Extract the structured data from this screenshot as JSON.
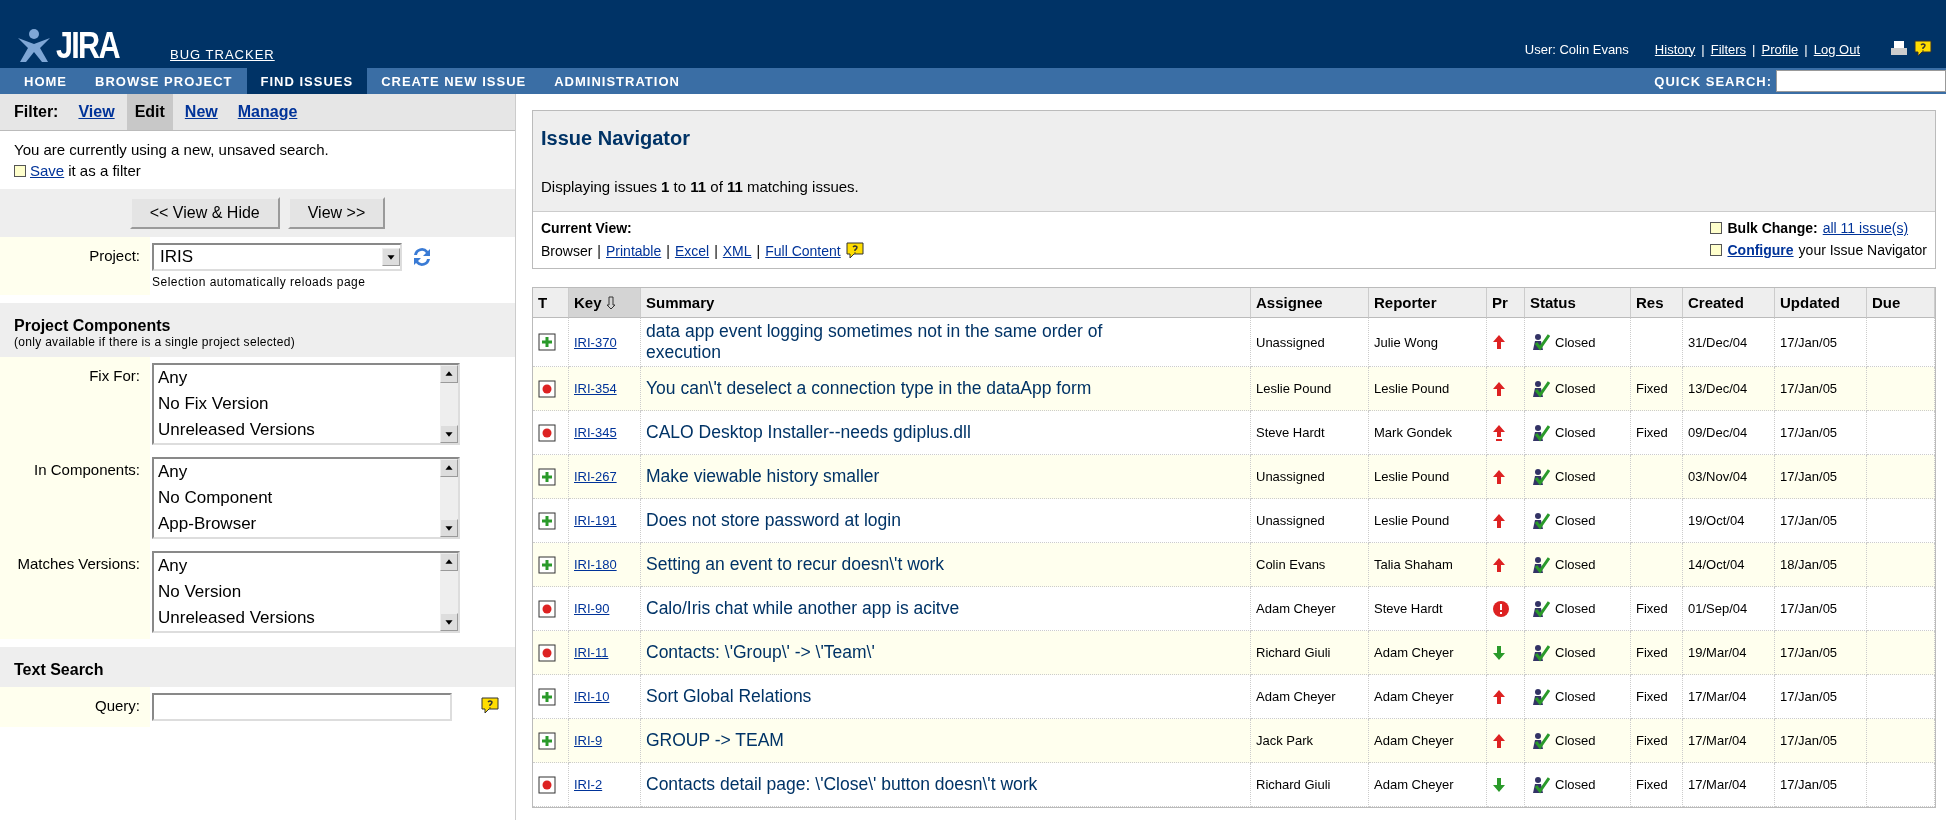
{
  "header": {
    "logo": "JIRA",
    "subtitle": "BUG TRACKER",
    "user": "User: Colin Evans",
    "links": [
      "History",
      "Filters",
      "Profile",
      "Log Out"
    ],
    "separator": "|"
  },
  "nav": {
    "tabs": [
      {
        "label": "HOME",
        "selected": false
      },
      {
        "label": "BROWSE PROJECT",
        "selected": false
      },
      {
        "label": "FIND ISSUES",
        "selected": true
      },
      {
        "label": "CREATE NEW ISSUE",
        "selected": false
      },
      {
        "label": "ADMINISTRATION",
        "selected": false
      }
    ],
    "quick_search": "QUICK SEARCH:"
  },
  "filter": {
    "label": "Filter:",
    "tabs": [
      {
        "label": "View",
        "selected": false
      },
      {
        "label": "Edit",
        "selected": true
      },
      {
        "label": "New",
        "selected": false
      },
      {
        "label": "Manage",
        "selected": false
      }
    ],
    "message": "You are currently using a new, unsaved search.",
    "save_link": "Save",
    "save_text": "it as a filter",
    "buttons": [
      "<< View & Hide",
      "View >>"
    ],
    "project_label": "Project:",
    "project_value": "IRIS",
    "project_hint": "Selection automatically reloads page"
  },
  "components": {
    "title": "Project Components",
    "note": "(only available if there is a single project selected)",
    "fields": [
      {
        "label": "Fix For:",
        "options": [
          "Any",
          "No Fix Version",
          "Unreleased Versions"
        ]
      },
      {
        "label": "In Components:",
        "options": [
          "Any",
          "No Component",
          "App-Browser"
        ]
      },
      {
        "label": "Matches Versions:",
        "options": [
          "Any",
          "No Version",
          "Unreleased Versions"
        ]
      }
    ]
  },
  "text_search": {
    "title": "Text Search",
    "query_label": "Query:"
  },
  "navigator": {
    "title": "Issue Navigator",
    "summary": "Displaying issues **1** to **11** of **11** matching issues.",
    "current_view_label": "Current View:",
    "views": [
      {
        "label": "Browser",
        "selected": true
      },
      {
        "label": "Printable",
        "selected": false
      },
      {
        "label": "Excel",
        "selected": false
      },
      {
        "label": "XML",
        "selected": false
      },
      {
        "label": "Full Content",
        "selected": false
      }
    ],
    "bulk_label": "Bulk Change:",
    "bulk_link": "all 11 issue(s)",
    "configure_link": "Configure",
    "configure_text": "your Issue Navigator",
    "separator": "|"
  },
  "table": {
    "columns": [
      {
        "label": "T",
        "sorted": false
      },
      {
        "label": "Key",
        "sorted": true
      },
      {
        "label": "Summary",
        "sorted": false
      },
      {
        "label": "Assignee",
        "sorted": false
      },
      {
        "label": "Reporter",
        "sorted": false
      },
      {
        "label": "Pr",
        "sorted": false
      },
      {
        "label": "Status",
        "sorted": false
      },
      {
        "label": "Res",
        "sorted": false
      },
      {
        "label": "Created",
        "sorted": false
      },
      {
        "label": "Updated",
        "sorted": false
      },
      {
        "label": "Due",
        "sorted": false
      }
    ],
    "rows": [
      {
        "type": {
          "kind": "improvement"
        },
        "key": "IRI-370",
        "summary": "data app event logging sometimes not in the same order of execution",
        "assignee": "Unassigned",
        "reporter": "Julie Wong",
        "priority": {
          "kind": "major"
        },
        "status": "Closed",
        "resolution": "",
        "created": "31/Dec/04",
        "updated": "17/Jan/05"
      },
      {
        "type": {
          "kind": "bug"
        },
        "key": "IRI-354",
        "summary": "You can\\'t deselect a connection type in the dataApp form",
        "assignee": "Leslie Pound",
        "reporter": "Leslie Pound",
        "priority": {
          "kind": "major"
        },
        "status": "Closed",
        "resolution": "Fixed",
        "created": "13/Dec/04",
        "updated": "17/Jan/05"
      },
      {
        "type": {
          "kind": "bug"
        },
        "key": "IRI-345",
        "summary": "CALO Desktop Installer--needs gdiplus.dll",
        "assignee": "Steve Hardt",
        "reporter": "Mark Gondek",
        "priority": {
          "kind": "critical"
        },
        "status": "Closed",
        "resolution": "Fixed",
        "created": "09/Dec/04",
        "updated": "17/Jan/05"
      },
      {
        "type": {
          "kind": "improvement"
        },
        "key": "IRI-267",
        "summary": "Make viewable history smaller",
        "assignee": "Unassigned",
        "reporter": "Leslie Pound",
        "priority": {
          "kind": "major"
        },
        "status": "Closed",
        "resolution": "",
        "created": "03/Nov/04",
        "updated": "17/Jan/05"
      },
      {
        "type": {
          "kind": "improvement"
        },
        "key": "IRI-191",
        "summary": "Does not store password at login",
        "assignee": "Unassigned",
        "reporter": "Leslie Pound",
        "priority": {
          "kind": "major"
        },
        "status": "Closed",
        "resolution": "",
        "created": "19/Oct/04",
        "updated": "17/Jan/05"
      },
      {
        "type": {
          "kind": "improvement"
        },
        "key": "IRI-180",
        "summary": "Setting an event to recur doesn\\'t work",
        "assignee": "Colin Evans",
        "reporter": "Talia Shaham",
        "priority": {
          "kind": "major"
        },
        "status": "Closed",
        "resolution": "",
        "created": "14/Oct/04",
        "updated": "18/Jan/05"
      },
      {
        "type": {
          "kind": "bug"
        },
        "key": "IRI-90",
        "summary": "Calo/Iris chat while another app is acitve",
        "assignee": "Adam Cheyer",
        "reporter": "Steve Hardt",
        "priority": {
          "kind": "blocker"
        },
        "status": "Closed",
        "resolution": "Fixed",
        "created": "01/Sep/04",
        "updated": "17/Jan/05"
      },
      {
        "type": {
          "kind": "bug"
        },
        "key": "IRI-11",
        "summary": "Contacts: \\'Group\\' -> \\'Team\\'",
        "assignee": "Richard Giuli",
        "reporter": "Adam Cheyer",
        "priority": {
          "kind": "minor"
        },
        "status": "Closed",
        "resolution": "Fixed",
        "created": "19/Mar/04",
        "updated": "17/Jan/05"
      },
      {
        "type": {
          "kind": "improvement"
        },
        "key": "IRI-10",
        "summary": "Sort Global Relations",
        "assignee": "Adam Cheyer",
        "reporter": "Adam Cheyer",
        "priority": {
          "kind": "major"
        },
        "status": "Closed",
        "resolution": "Fixed",
        "created": "17/Mar/04",
        "updated": "17/Jan/05"
      },
      {
        "type": {
          "kind": "improvement"
        },
        "key": "IRI-9",
        "summary": "GROUP -> TEAM",
        "assignee": "Jack Park",
        "reporter": "Adam Cheyer",
        "priority": {
          "kind": "major"
        },
        "status": "Closed",
        "resolution": "Fixed",
        "created": "17/Mar/04",
        "updated": "17/Jan/05"
      },
      {
        "type": {
          "kind": "bug"
        },
        "key": "IRI-2",
        "summary": "Contacts detail page: \\'Close\\' button doesn\\'t work",
        "assignee": "Richard Giuli",
        "reporter": "Adam Cheyer",
        "priority": {
          "kind": "minor"
        },
        "status": "Closed",
        "resolution": "Fixed",
        "created": "17/Mar/04",
        "updated": "17/Jan/05"
      }
    ]
  }
}
